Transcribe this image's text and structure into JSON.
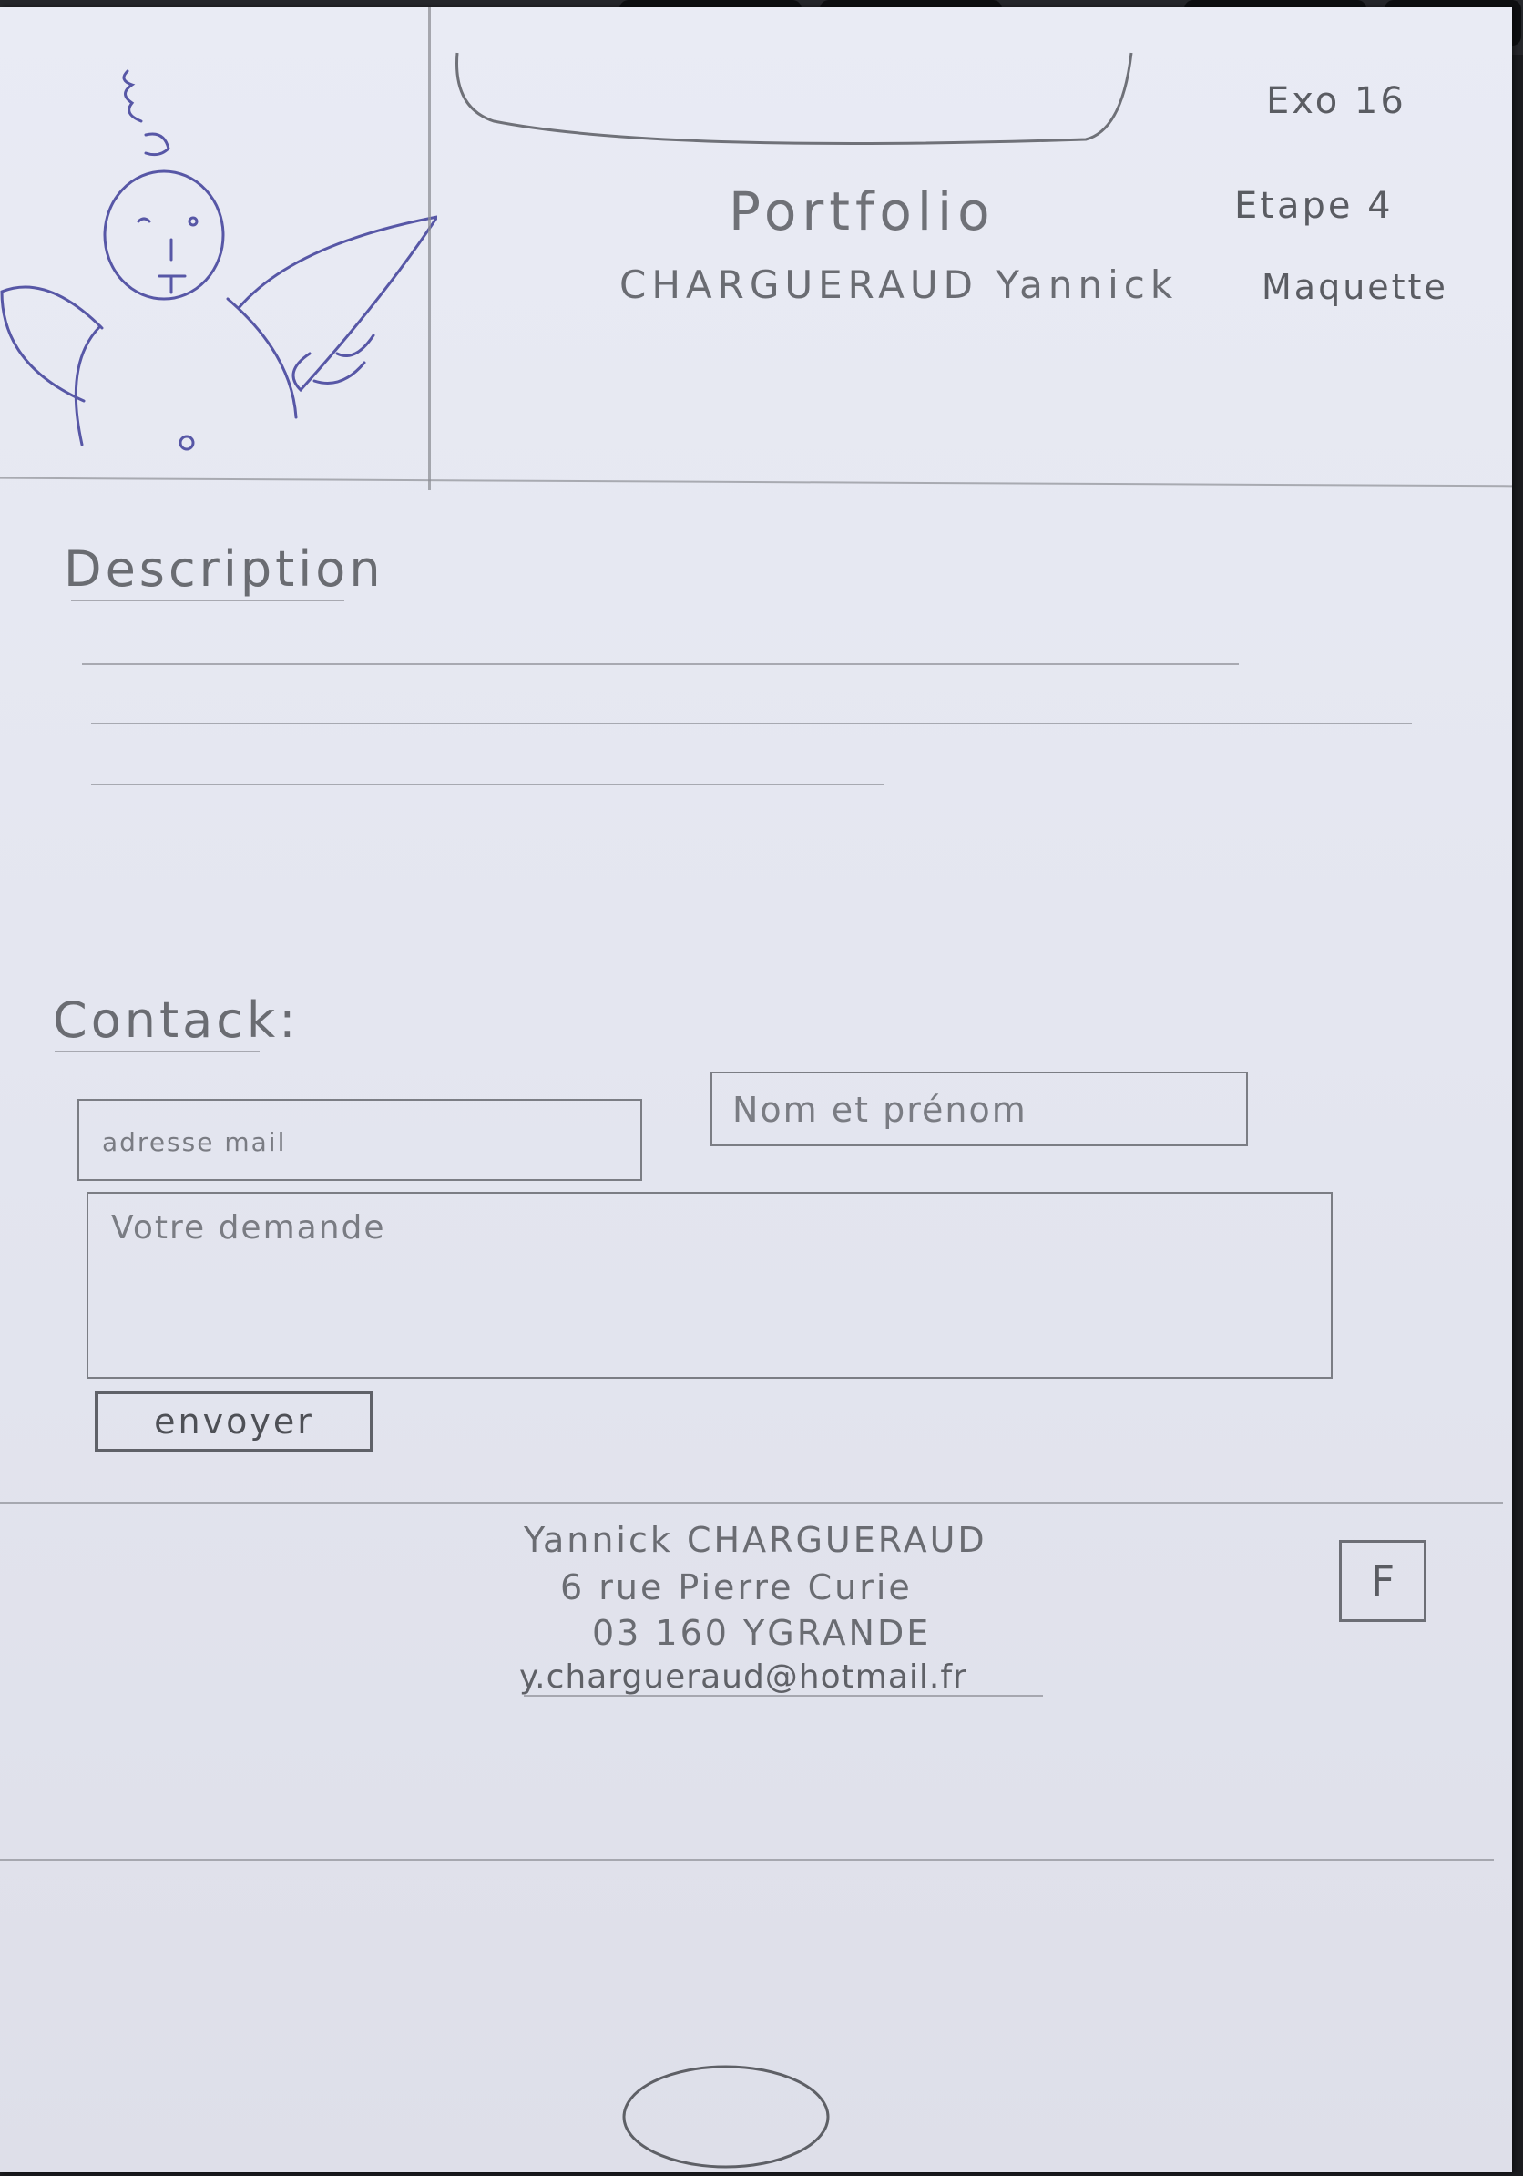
{
  "header": {
    "exercise": "Exo 16",
    "step": "Etape 4",
    "step_sub": "Maquette",
    "site_title": "Portfolio",
    "author": "CHARGUERAUD Yannick"
  },
  "logo": {
    "icon": "stick-figure-angel-icon"
  },
  "description": {
    "heading": "Description"
  },
  "contact": {
    "heading": "Contack:",
    "email_placeholder": "adresse mail",
    "name_placeholder": "Nom et prénom",
    "message_placeholder": "Votre demande",
    "submit_label": "envoyer"
  },
  "footer": {
    "name": "Yannick CHARGUERAUD",
    "street": "6 rue Pierre Curie",
    "city": "03 160 YGRANDE",
    "email": "y.chargueraud@hotmail.fr",
    "facebook_label": "F"
  },
  "device": {
    "home_button_icon": "home-button-icon"
  },
  "colors": {
    "paper": "#e6e8f1",
    "pencil": "#6a6c72",
    "pen": "#5757a6"
  }
}
